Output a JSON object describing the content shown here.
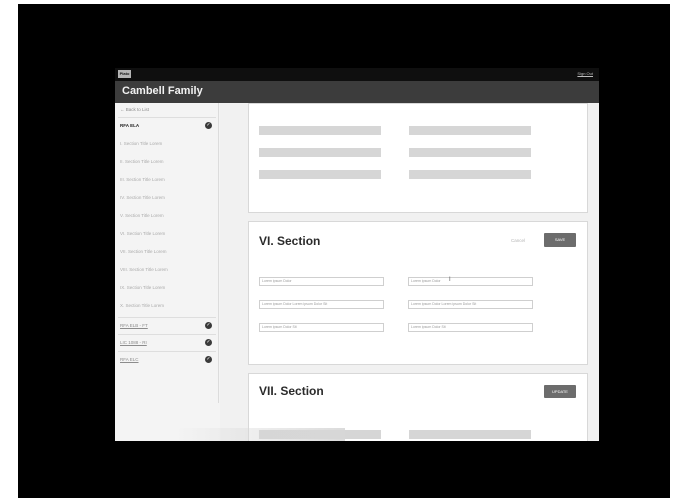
{
  "topbar": {
    "logo": "Plato",
    "link": "Sign Out"
  },
  "header": {
    "title": "Cambell Family"
  },
  "sidebar": {
    "back": "Back to List",
    "active_item": "RFA ELA",
    "sections": [
      "I. Section Title Lorem",
      "II. Section Title Lorem",
      "III. Section Title Lorem",
      "IV. Section Title Lorem",
      "V. Section Title Lorem",
      "VI. Section Title Lorem",
      "VII. Section Title Lorem",
      "VIII. Section Title Lorem",
      "IX. Section Title Lorem",
      "X. Section Title Lorem"
    ],
    "groups": [
      "RFA ELB - FT",
      "LIC 1088 - RI",
      "RFA ELC"
    ]
  },
  "section6": {
    "title": "VI. Section",
    "cancel": "Cancel",
    "save": "SAVE",
    "fields": [
      "Lorem ipsum Dolor",
      "Lorem ipsum Dolor",
      "Lorem ipsum Dolor Lorem ipsum Dolor Sit",
      "Lorem ipsum Dolor Lorem ipsum Dolor Sit",
      "Lorem ipsum Dolor Sit",
      "Lorem ipsum Dolor Sit"
    ]
  },
  "section7": {
    "title": "VII. Section",
    "update": "UPDATE"
  }
}
